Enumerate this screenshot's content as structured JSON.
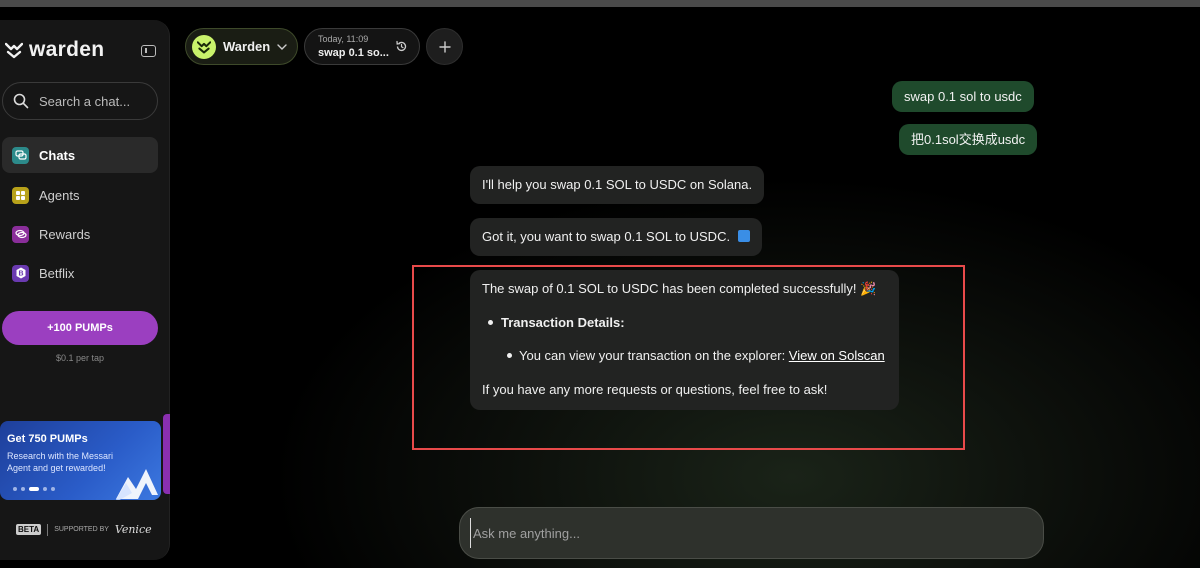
{
  "sidebar": {
    "brand": "warden",
    "search_placeholder": "Search a chat...",
    "items": [
      {
        "label": "Chats",
        "icon": "chat-icon",
        "color": "#2c8a8a",
        "active": true
      },
      {
        "label": "Agents",
        "icon": "agents-icon",
        "color": "#b8a21a",
        "active": false
      },
      {
        "label": "Rewards",
        "icon": "rewards-icon",
        "color": "#8a2e9a",
        "active": false
      },
      {
        "label": "Betflix",
        "icon": "betflix-icon",
        "color": "#6a3ab0",
        "active": false
      }
    ],
    "pumps_button": "+100 PUMPs",
    "pumps_sub": "$0.1 per tap",
    "promo": {
      "title": "Get 750 PUMPs",
      "desc": "Research with the Messari Agent and get rewarded!"
    },
    "footer": {
      "beta": "BETA",
      "supported_by": "SUPPORTED BY",
      "partner": "Venice"
    }
  },
  "header": {
    "agent_name": "Warden",
    "chat_time": "Today, 11:09",
    "chat_title": "swap 0.1 so..."
  },
  "messages": {
    "user_1": "swap 0.1 sol to usdc",
    "user_2": "把0.1sol交换成usdc",
    "bot_1": "I'll help you swap 0.1 SOL to USDC on Solana.",
    "bot_2": "Got it, you want to swap 0.1 SOL to USDC.",
    "bot_3": {
      "line1": "The swap of 0.1 SOL to USDC has been completed successfully! 🎉",
      "details_label": "Transaction Details",
      "details_colon": ":",
      "explorer_text": "You can view your transaction on the explorer: ",
      "link_text": "View on Solscan",
      "closing": "If you have any more requests or questions, feel free to ask!"
    }
  },
  "composer": {
    "placeholder": "Ask me anything..."
  },
  "colors": {
    "accent_green": "#1f4a2c",
    "pumps_purple": "#9b3fc0",
    "highlight_red": "#e84a4a"
  }
}
